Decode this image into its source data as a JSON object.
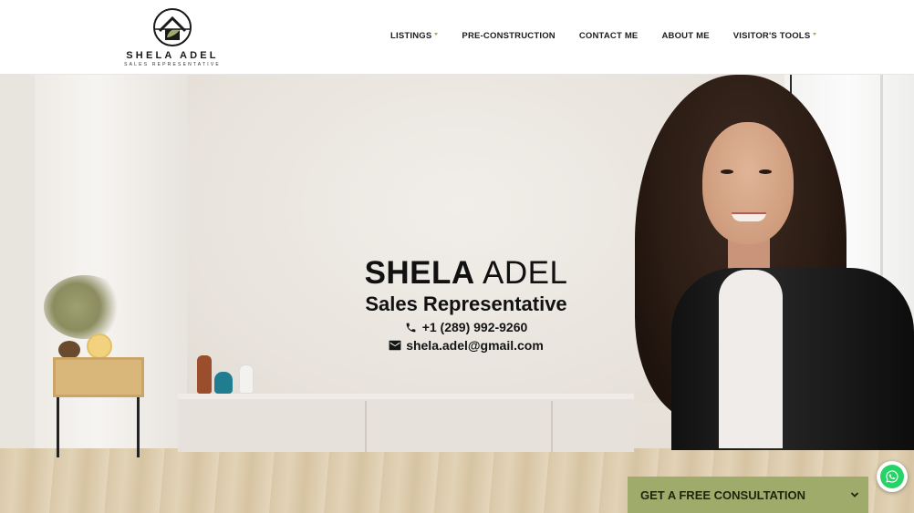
{
  "brand": {
    "name": "SHELA ADEL",
    "tagline": "SALES REPRESENTATIVE"
  },
  "nav": {
    "items": [
      {
        "label": "LISTINGS",
        "has_dropdown": true
      },
      {
        "label": "PRE-CONSTRUCTION",
        "has_dropdown": false
      },
      {
        "label": "CONTACT ME",
        "has_dropdown": false
      },
      {
        "label": "ABOUT ME",
        "has_dropdown": false
      },
      {
        "label": "VISITOR'S TOOLS",
        "has_dropdown": true
      }
    ]
  },
  "hero": {
    "first_name": "SHELA",
    "last_name": "ADEL",
    "role": "Sales Representative",
    "phone": "+1 (289) 992-9260",
    "email": "shela.adel@gmail.com"
  },
  "cta": {
    "label": "GET A FREE CONSULTATION",
    "icon": "chevron-down-icon"
  },
  "chat": {
    "icon": "whatsapp-icon"
  },
  "colors": {
    "accent": "#9fab6b",
    "text": "#111111",
    "whatsapp": "#25d366"
  }
}
